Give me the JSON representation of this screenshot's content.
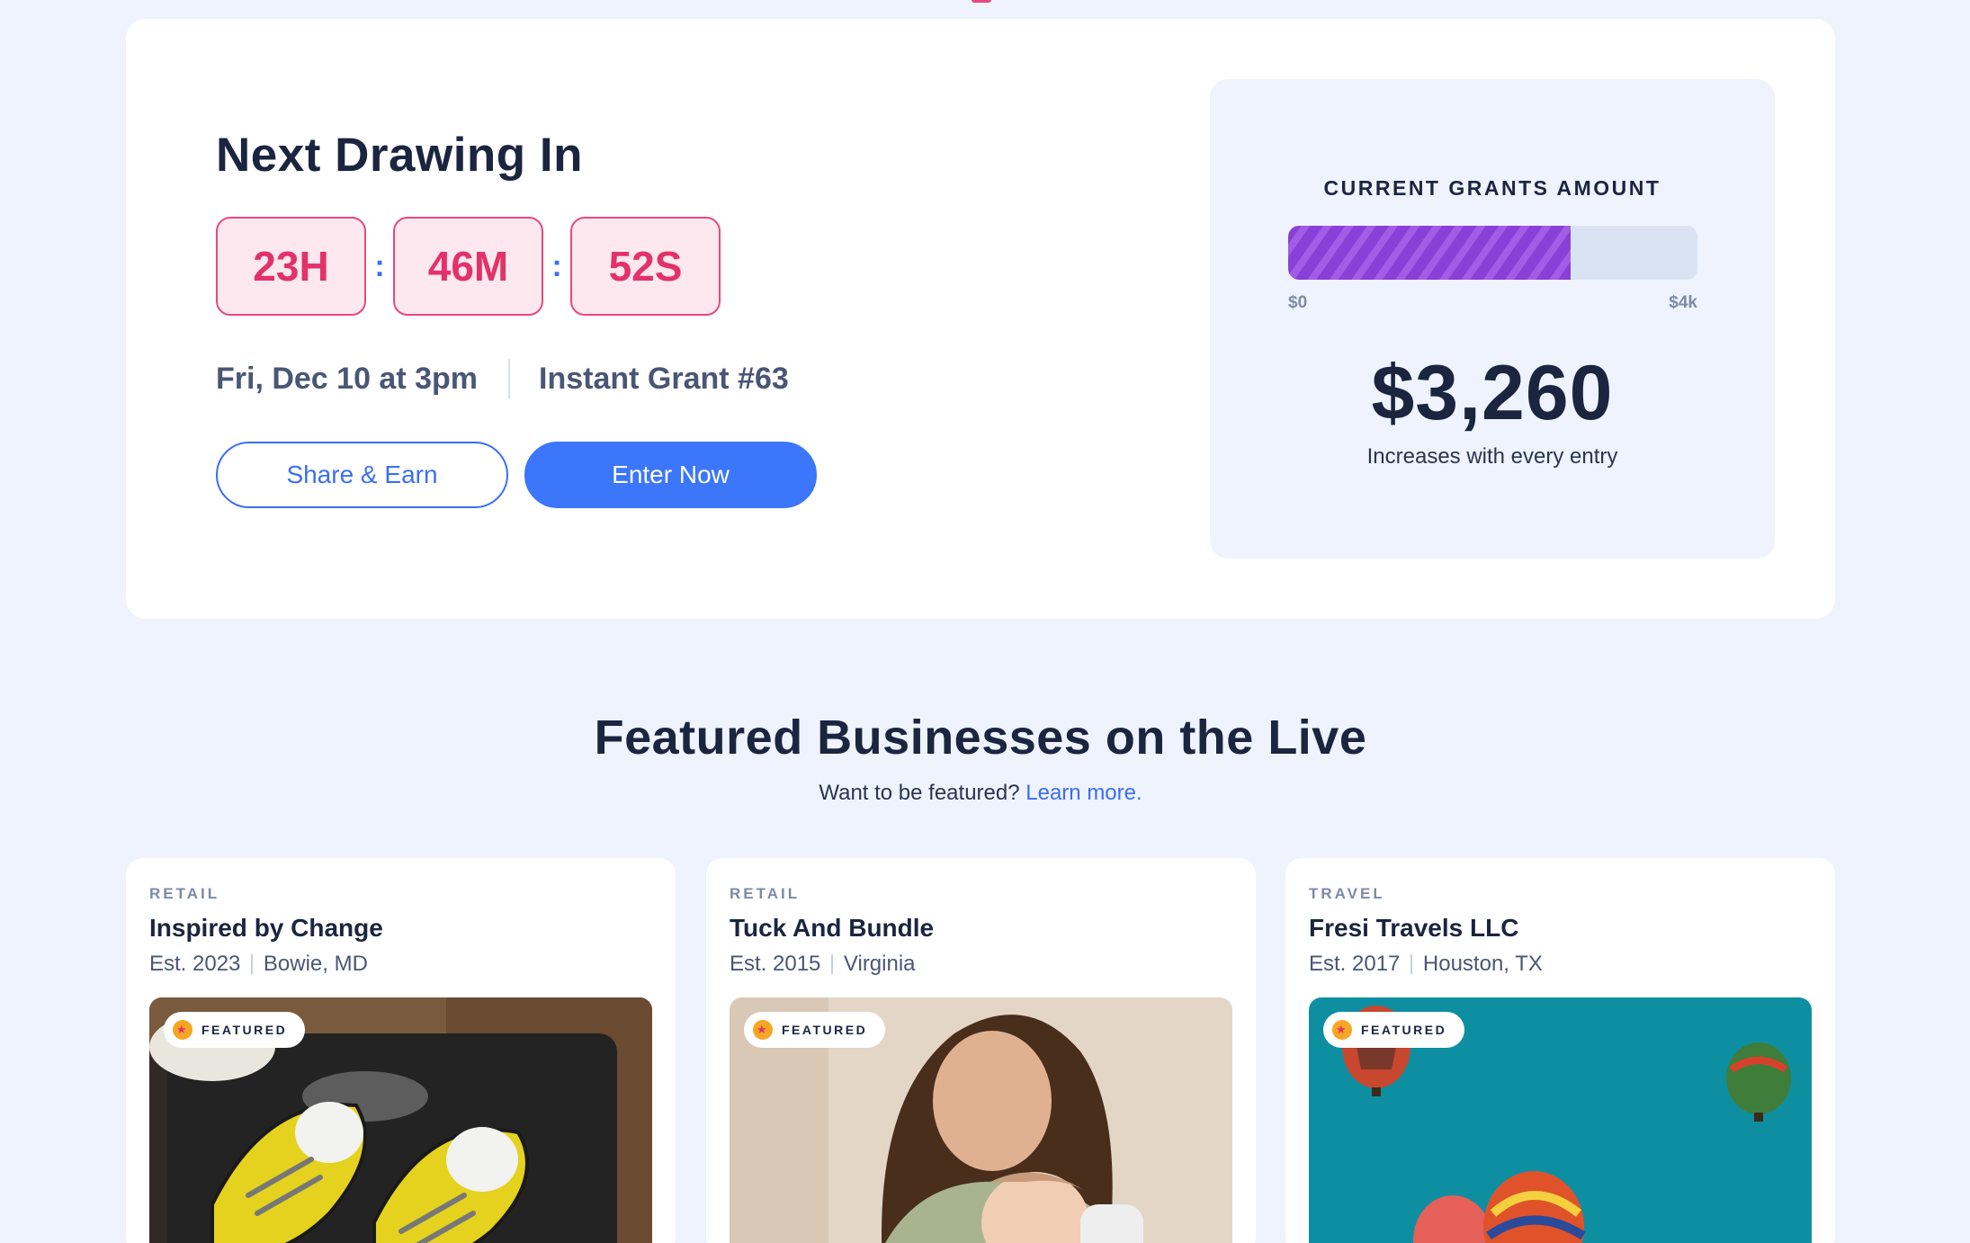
{
  "drawing": {
    "title": "Next Drawing In",
    "timer": {
      "hours": "23H",
      "minutes": "46M",
      "seconds": "52S",
      "separator": ":"
    },
    "date": "Fri, Dec 10 at 3pm",
    "grant_name": "Instant Grant #63",
    "share_label": "Share & Earn",
    "enter_label": "Enter Now"
  },
  "grants": {
    "label": "CURRENT GRANTS AMOUNT",
    "min_label": "$0",
    "max_label": "$4k",
    "progress_fraction": 0.69,
    "amount": "$3,260",
    "subtext": "Increases with every entry"
  },
  "featured": {
    "title": "Featured Businesses on the Live",
    "prompt": "Want to be featured?",
    "link_label": "Learn more.",
    "badge_label": "FEATURED",
    "cards": [
      {
        "category": "RETAIL",
        "name": "Inspired by Change",
        "est": "Est. 2023",
        "location": "Bowie, MD"
      },
      {
        "category": "RETAIL",
        "name": "Tuck And Bundle",
        "est": "Est. 2015",
        "location": "Virginia"
      },
      {
        "category": "TRAVEL",
        "name": "Fresi Travels LLC",
        "est": "Est. 2017",
        "location": "Houston, TX"
      }
    ]
  },
  "colors": {
    "accent": "#3b76fb",
    "timer": "#e3316a",
    "progress": "#8a3fd7",
    "background": "#eef3fd"
  }
}
